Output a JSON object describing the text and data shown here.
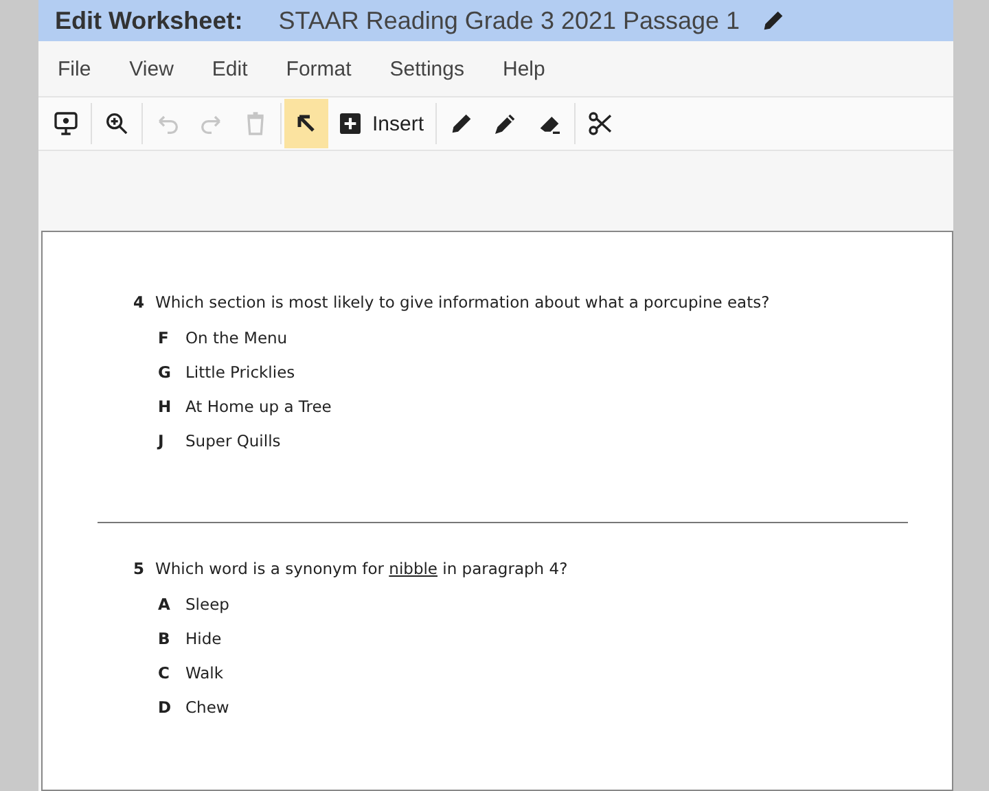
{
  "window": {
    "title_label": "Edit Worksheet:",
    "title": "STAAR Reading Grade 3 2021 Passage 1"
  },
  "menu": [
    "File",
    "View",
    "Edit",
    "Format",
    "Settings",
    "Help"
  ],
  "toolbar": [
    {
      "kind": "present",
      "disabled": false,
      "selected": false
    },
    {
      "kind": "zoom",
      "disabled": false,
      "selected": false
    },
    {
      "kind": "undo",
      "disabled": true,
      "selected": false
    },
    {
      "kind": "redo",
      "disabled": true,
      "selected": false
    },
    {
      "kind": "delete",
      "disabled": true,
      "selected": false
    },
    {
      "kind": "select",
      "disabled": false,
      "selected": true
    },
    {
      "kind": "insert",
      "label": "Insert",
      "disabled": false,
      "selected": false
    },
    {
      "kind": "pencil",
      "disabled": false,
      "selected": false
    },
    {
      "kind": "marker",
      "disabled": false,
      "selected": false
    },
    {
      "kind": "eraser",
      "disabled": false,
      "selected": false
    },
    {
      "kind": "cut",
      "disabled": false,
      "selected": false
    }
  ],
  "questions": [
    {
      "number": "4",
      "text_before": "Which section is most likely to give information about what a porcupine eats?",
      "choices": [
        {
          "letter": "F",
          "text": "On the Menu"
        },
        {
          "letter": "G",
          "text": "Little Pricklies"
        },
        {
          "letter": "H",
          "text": "At Home up a Tree"
        },
        {
          "letter": "J",
          "text": "Super Quills"
        }
      ]
    },
    {
      "number": "5",
      "text_before": "Which word is a synonym for ",
      "underlined": "nibble",
      "text_after": " in paragraph 4?",
      "choices": [
        {
          "letter": "A",
          "text": "Sleep"
        },
        {
          "letter": "B",
          "text": "Hide"
        },
        {
          "letter": "C",
          "text": "Walk"
        },
        {
          "letter": "D",
          "text": "Chew"
        }
      ]
    }
  ]
}
